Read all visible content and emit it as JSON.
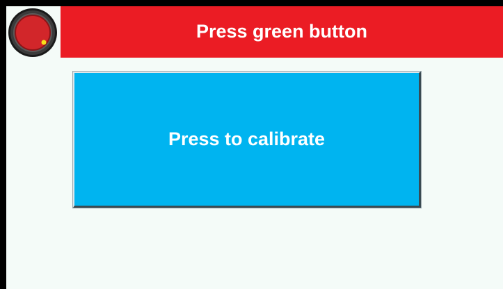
{
  "header": {
    "title": "Press green button",
    "background": "#eb1c24"
  },
  "status_indicator": {
    "icon": "rotary-knob-icon",
    "colors": {
      "bezel": "#2a2a2a",
      "face": "#d2262a",
      "marker": "#f7e21a"
    }
  },
  "calibrate_button": {
    "label": "Press to calibrate",
    "background": "#00b4f0"
  },
  "screen": {
    "background": "#f4fbf8",
    "frame": "#000000"
  }
}
